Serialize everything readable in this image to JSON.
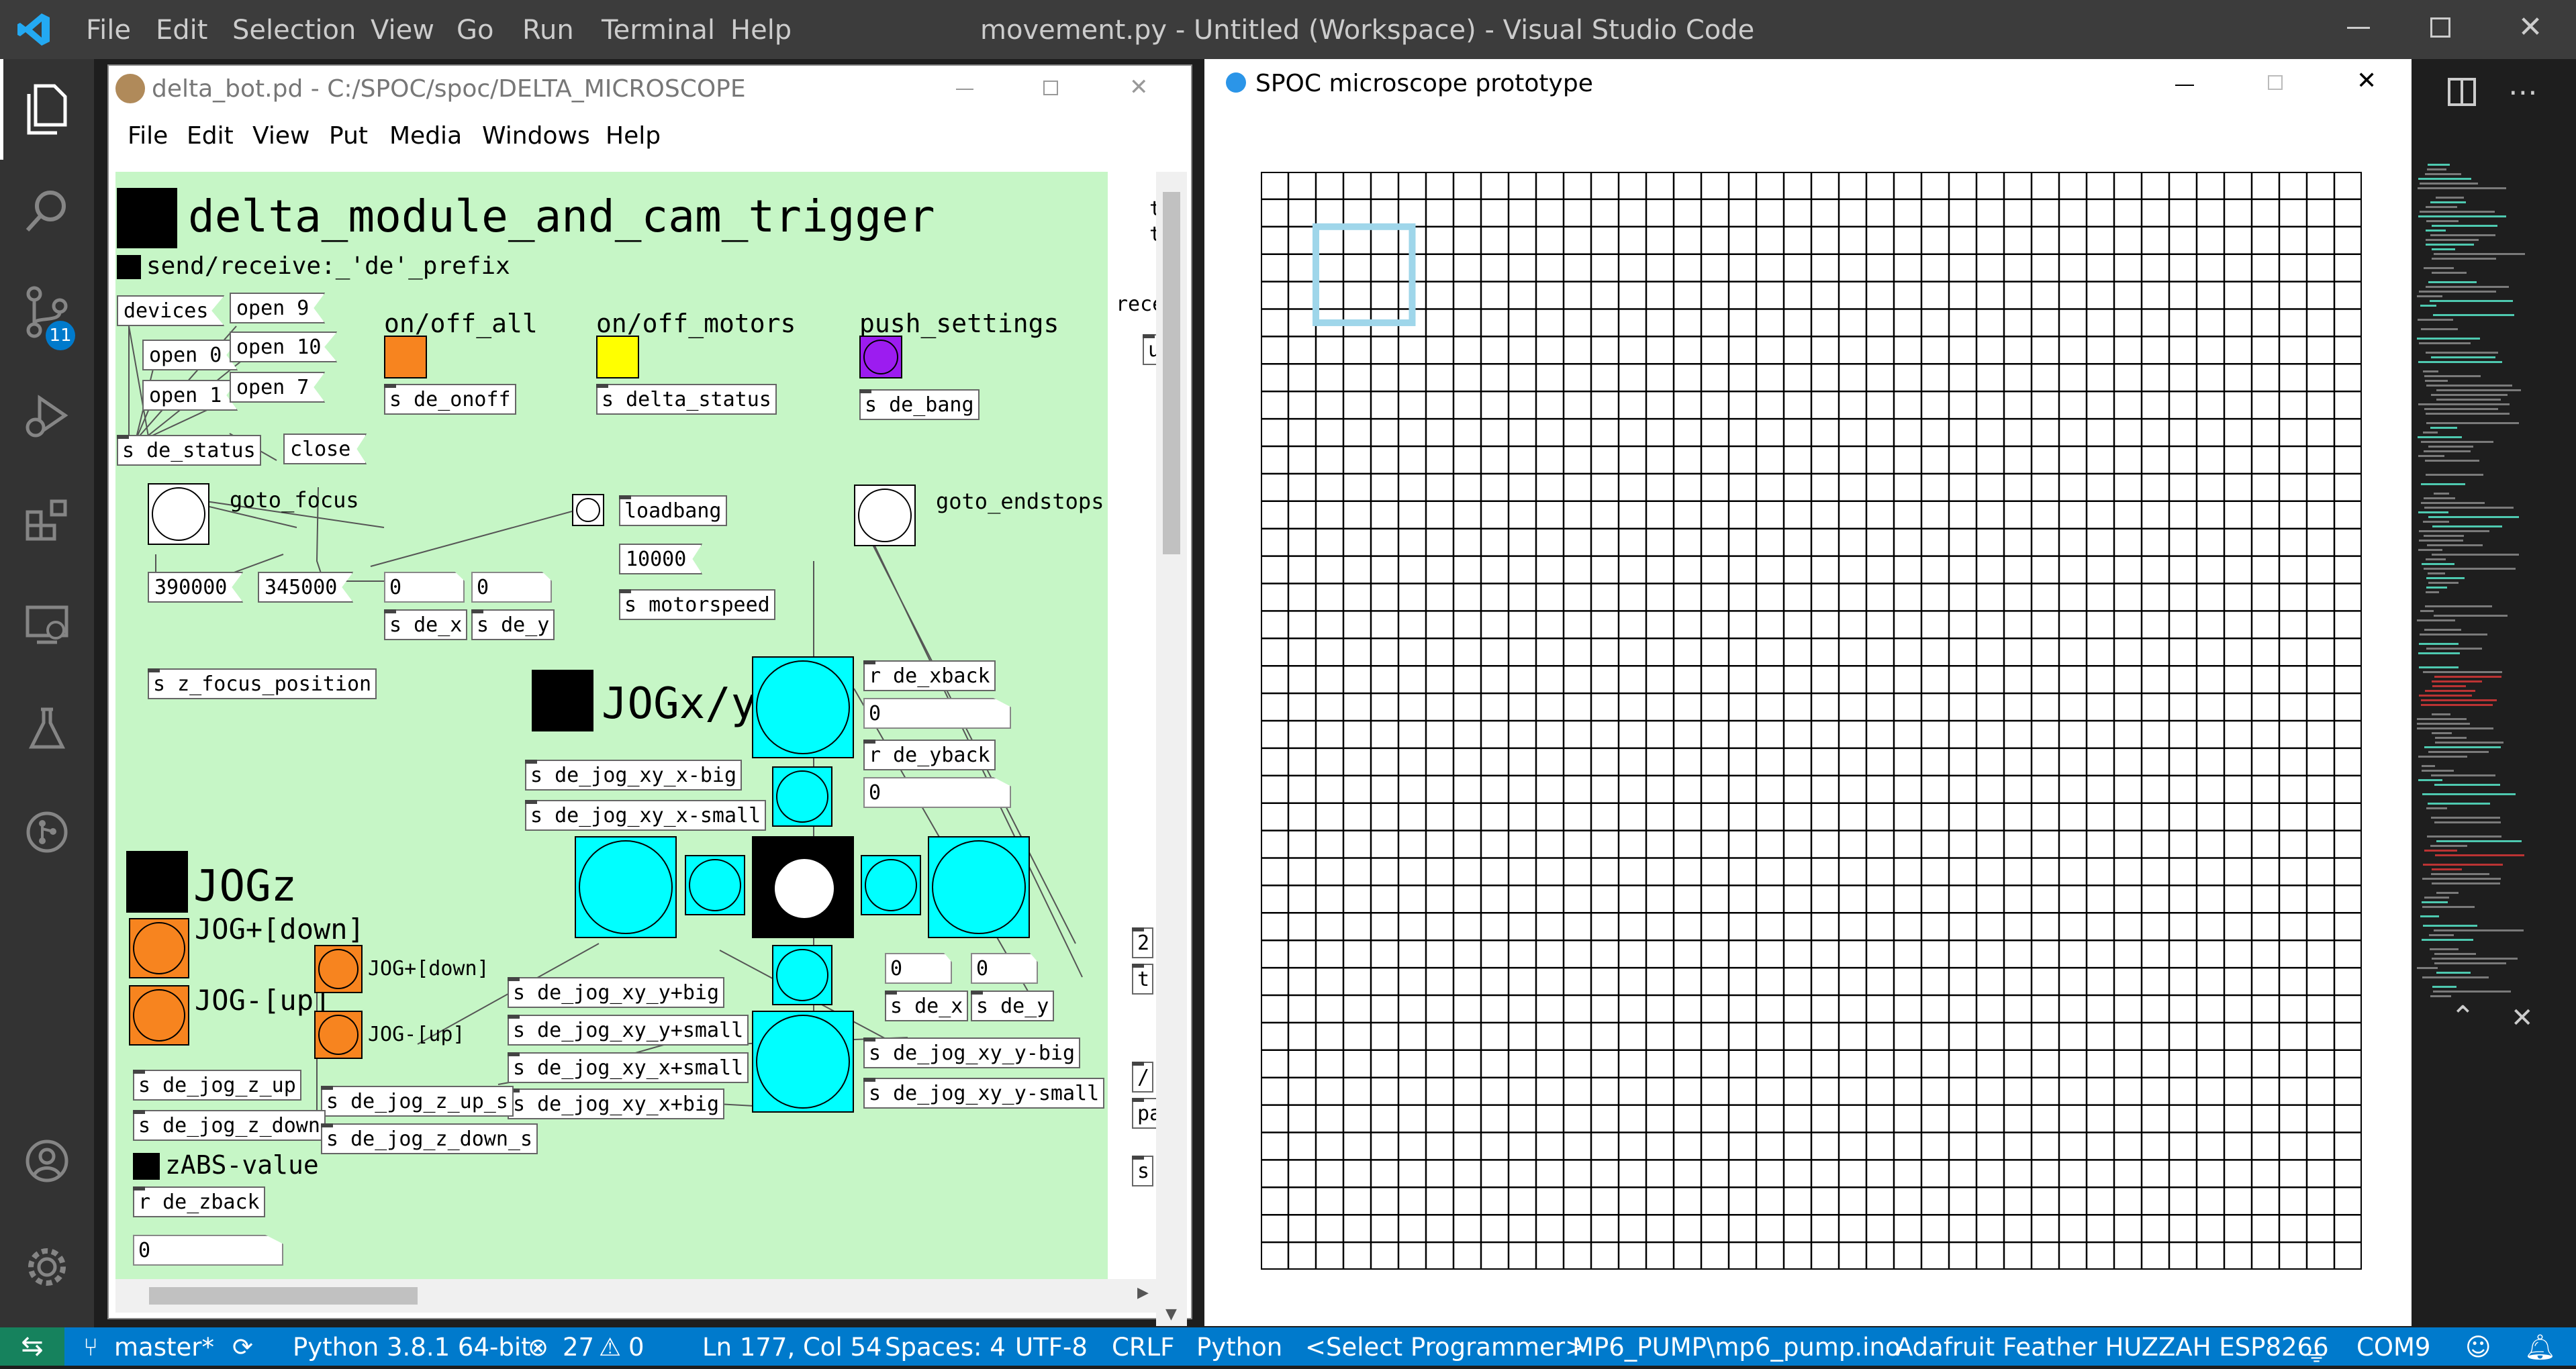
{
  "vscode": {
    "menu": [
      "File",
      "Edit",
      "Selection",
      "View",
      "Go",
      "Run",
      "Terminal",
      "Help"
    ],
    "title": "movement.py - Untitled (Workspace) - Visual Studio Code",
    "activity_badge": "11",
    "status": {
      "branch": "master*",
      "python": "Python 3.8.1 64-bit",
      "errors": "27",
      "warnings": "0",
      "position": "Ln 177, Col 54",
      "spaces": "Spaces: 4",
      "encoding": "UTF-8",
      "eol": "CRLF",
      "language": "Python",
      "programmer": "<Select Programmer>",
      "sketch": "MP6_PUMP\\mp6_pump.ino",
      "board": "Adafruit Feather HUZZAH ESP8266",
      "port": "COM9"
    },
    "accent": "#007acc"
  },
  "pd": {
    "title": "delta_bot.pd  - C:/SPOC/spoc/DELTA_MICROSCOPE",
    "menu": [
      "File",
      "Edit",
      "View",
      "Put",
      "Media",
      "Windows",
      "Help"
    ],
    "heading": "delta_module_and_cam_trigger",
    "prefix": "send/receive:_'de'_prefix",
    "labels": {
      "onoff_all": "on/off_all",
      "onoff_motors": "on/off_motors",
      "push_settings": "push_settings",
      "goto_focus": "goto_focus",
      "goto_endstops": "goto_endstops",
      "jogxy": "JOGx/y",
      "jogz": "JOGz",
      "jog_down": "JOG+[down]",
      "jog_up": "JOG-[up]",
      "jog_down_small": "JOG+[down]",
      "jog_up_small": "JOG-[up]",
      "zabs": "zABS-value",
      "right_t1": "t",
      "right_t2": "t",
      "right_rece": "rece"
    },
    "messages": {
      "devices": "devices",
      "open9": "open 9",
      "open0": "open 0",
      "open10": "open 10",
      "open1": "open 1",
      "open7": "open 7",
      "close": "close",
      "v390000": "390000",
      "v345000": "345000",
      "v10000": "10000"
    },
    "objects": {
      "de_status": "s de_status",
      "de_onoff": "s de_onoff",
      "delta_status": "s delta_status",
      "de_bang": "s de_bang",
      "loadbang": "loadbang",
      "motorspeed": "s motorspeed",
      "z_focus": "s z_focus_position",
      "de_x": "s de_x",
      "de_y": "s de_y",
      "r_xback": "r de_xback",
      "r_yback": "r de_yback",
      "jog_x_big": "s de_jog_xy_x-big",
      "jog_x_small": "s de_jog_xy_x-small",
      "jog_y_big_p": "s de_jog_xy_y+big",
      "jog_y_small_p": "s de_jog_xy_y+small",
      "jog_x_small_p": "s de_jog_xy_x+small",
      "jog_x_big_p": "s de_jog_xy_x+big",
      "de_x2": "s de_x",
      "de_y2": "s de_y",
      "jog_y_big_m": "s de_jog_xy_y-big",
      "jog_y_small_m": "s de_jog_xy_y-small",
      "jog_z_up": "s de_jog_z_up",
      "jog_z_down": "s de_jog_z_down",
      "jog_z_up_s": "s de_jog_z_up_s",
      "jog_z_down_s": "s de_jog_z_down_s",
      "r_zback": "r de_zback",
      "right_u": "u",
      "right_2": "2",
      "right_t": "t",
      "right_slash": "/",
      "right_pa": "pa",
      "right_s": "s"
    },
    "numbers": {
      "n1": "0",
      "n2": "0",
      "n3": "0",
      "n4": "0",
      "n5": "0",
      "n6": "0",
      "n7": "0"
    },
    "colors": {
      "canvas": "#c6f6c6",
      "orange": "#f7841f",
      "yellow": "#ffff00",
      "purple": "#9c1cf0",
      "cyan": "#00ffff"
    }
  },
  "spoc": {
    "title": "SPOC microscope prototype",
    "grid_cols": 40,
    "grid_rows": 40,
    "highlight_color": "#9fd6ea"
  }
}
